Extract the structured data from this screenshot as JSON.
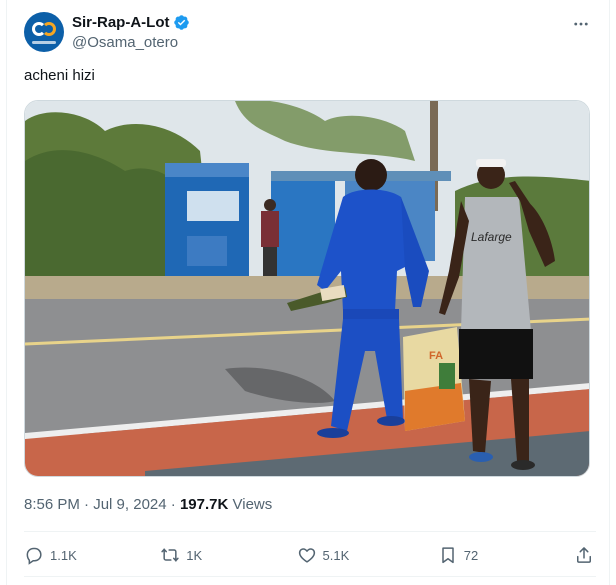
{
  "author": {
    "display_name": "Sir-Rap-A-Lot",
    "handle": "@Osama_otero",
    "avatar_icon": "logo-avatar-icon",
    "verified_icon": "verified-badge-icon",
    "verified_color": "#1d9bf0"
  },
  "tweet": {
    "text": "acheni hizi"
  },
  "media": {
    "bag_text": "Lafarge"
  },
  "meta": {
    "time": "8:56 PM",
    "separator": "·",
    "date": "Jul 9, 2024",
    "views_count": "197.7K",
    "views_label": "Views"
  },
  "actions": {
    "reply_count": "1.1K",
    "repost_count": "1K",
    "like_count": "5.1K",
    "bookmark_count": "72",
    "reply_icon": "reply-icon",
    "repost_icon": "repost-icon",
    "like_icon": "heart-icon",
    "bookmark_icon": "bookmark-icon",
    "share_icon": "share-icon"
  },
  "colors": {
    "text_primary": "#0f1419",
    "text_secondary": "#536471",
    "border": "#cfd9de"
  }
}
